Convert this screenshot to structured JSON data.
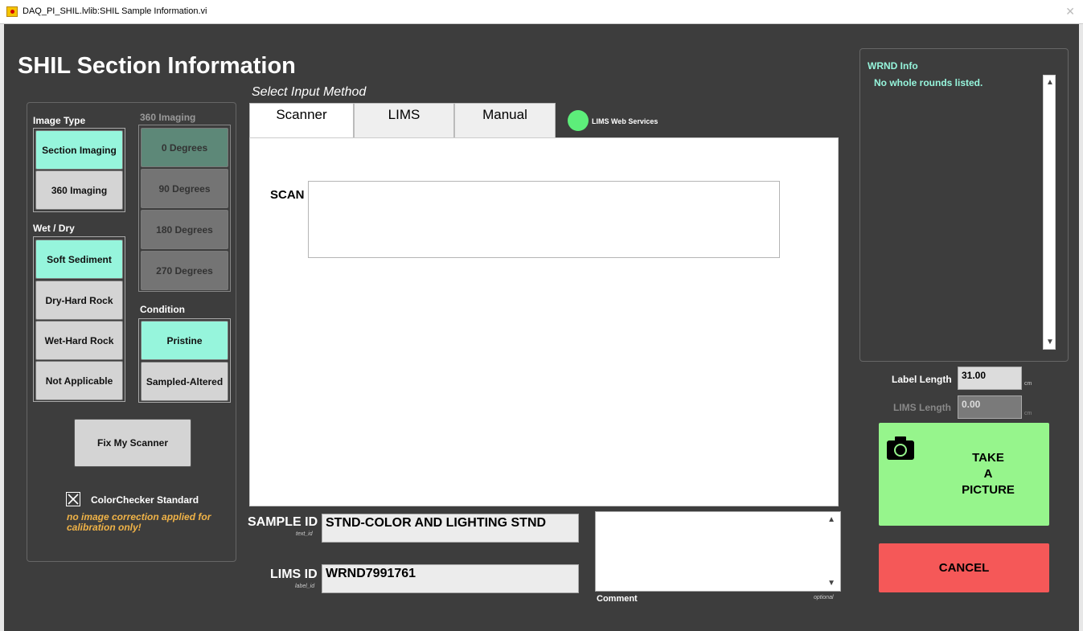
{
  "window": {
    "title": "DAQ_PI_SHIL.lvlib:SHIL Sample Information.vi",
    "close_glyph": "✕"
  },
  "page_title": "SHIL Section Information",
  "image_type": {
    "label": "Image Type",
    "options": [
      "Section Imaging",
      "360 Imaging"
    ],
    "selected": "Section Imaging"
  },
  "imaging_360": {
    "label": "360 Imaging",
    "options": [
      "0 Degrees",
      "90 Degrees",
      "180 Degrees",
      "270 Degrees"
    ],
    "selected": "0 Degrees"
  },
  "wet_dry": {
    "label": "Wet / Dry",
    "options": [
      "Soft Sediment",
      "Dry-Hard Rock",
      "Wet-Hard Rock",
      "Not Applicable"
    ],
    "selected": "Soft Sediment"
  },
  "condition": {
    "label": "Condition",
    "options": [
      "Pristine",
      "Sampled-Altered"
    ],
    "selected": "Pristine"
  },
  "fix_scanner_label": "Fix My Scanner",
  "colorchecker": {
    "label": "ColorChecker Standard",
    "note": "no image correction applied for calibration only!",
    "checked": true
  },
  "input_method": {
    "label": "Select Input Method",
    "tabs": [
      "Scanner",
      "LIMS",
      "Manual"
    ],
    "active": "Scanner",
    "lims_status": {
      "label": "LIMS Web Services",
      "color": "#5dee7a"
    }
  },
  "scan": {
    "label": "SCAN",
    "value": ""
  },
  "sample_id": {
    "label": "SAMPLE ID",
    "sublabel": "text_id",
    "value": "STND-COLOR AND LIGHTING STND"
  },
  "lims_id": {
    "label": "LIMS ID",
    "sublabel": "label_id",
    "value": "WRND7991761"
  },
  "comment": {
    "label": "Comment",
    "hint": "optional",
    "value": ""
  },
  "wrnd": {
    "label": "WRND Info",
    "message": "No whole rounds listed."
  },
  "label_length": {
    "label": "Label Length",
    "value": "31.00",
    "unit": "cm"
  },
  "lims_length": {
    "label": "LIMS Length",
    "value": "0.00",
    "unit": "cm"
  },
  "take_picture": {
    "line1": "TAKE",
    "line2": "A",
    "line3": "PICTURE",
    "icon": "camera-icon"
  },
  "cancel_label": "CANCEL",
  "colors": {
    "selected": "#96f5dc",
    "take_picture": "#96f58c",
    "cancel": "#f55858",
    "note": "#f0b347"
  }
}
